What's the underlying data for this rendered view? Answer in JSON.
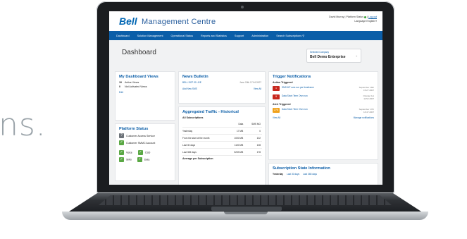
{
  "backdrop": {
    "text": "ns."
  },
  "header": {
    "brand": "Bell",
    "app_title": "Management Centre",
    "user_name": "David Murray",
    "platform_status": "Platform Status",
    "logout": "Log out",
    "language_label": "Language",
    "language_value": "English"
  },
  "nav": [
    "Dashboard",
    "Solution Management",
    "Operational Status",
    "Reports and Statistics",
    "Support",
    "Administration",
    "Search Subscriptions"
  ],
  "page": {
    "title": "Dashboard",
    "company_label": "Selected Company",
    "company_value": "Bell Demo Enterprise"
  },
  "views": {
    "title": "My Dashboard Views",
    "rows": [
      {
        "count": "10",
        "label": "Active Views"
      },
      {
        "count": "0",
        "label": "Not Activated Views"
      }
    ],
    "edit": "Edit"
  },
  "platform": {
    "title": "Platform Status",
    "items": [
      "Customer Access Service",
      "Customer SMMC Account"
    ],
    "services": [
      "Voice",
      "CSD",
      "SMS",
      "Data"
    ]
  },
  "news": {
    "title": "News Bulletin",
    "item_title": "BELL DCP IS LIVE",
    "item_date": "June 15th 17:04 2007",
    "add_link": "Add New SMS",
    "view_all": "View All"
  },
  "traffic": {
    "title": "Aggregated Traffic - Historical",
    "subtitle": "All Subscriptions",
    "headers": [
      "",
      "Data",
      "SMS MO"
    ],
    "rows": [
      [
        "Yesterday",
        "17 MB",
        "0"
      ],
      [
        "From the start of the month",
        "1000 MB",
        "102"
      ],
      [
        "Last 30 days",
        "1100 MB",
        "108"
      ],
      [
        "Last 365 days",
        "5233 MB",
        "178"
      ]
    ],
    "average": "Average per Subscription"
  },
  "triggers": {
    "title": "Trigger Notifications",
    "section_action": "Action Triggered",
    "section_alert": "Alert Triggered",
    "action_items": [
      {
        "count": "1",
        "text": "SMS MT over-run per timeframe",
        "date": "September 16th 15:27 2007",
        "color": "#c8281e"
      },
      {
        "count": "9",
        "text": "Data Short Term Over-run",
        "date": "October 1st 11:52 2007",
        "color": "#c8281e"
      }
    ],
    "alert_items": [
      {
        "count": "276",
        "text": "Data Short Term Over-run",
        "date": "September 17th 16:47 2007",
        "color": "#f0a21c"
      }
    ],
    "view_all": "View All",
    "manage": "Manage notifications"
  },
  "subscription_state": {
    "title": "Subscription State Information",
    "links": [
      "Yesterday",
      "Last 30 days",
      "Last 365 days"
    ]
  }
}
